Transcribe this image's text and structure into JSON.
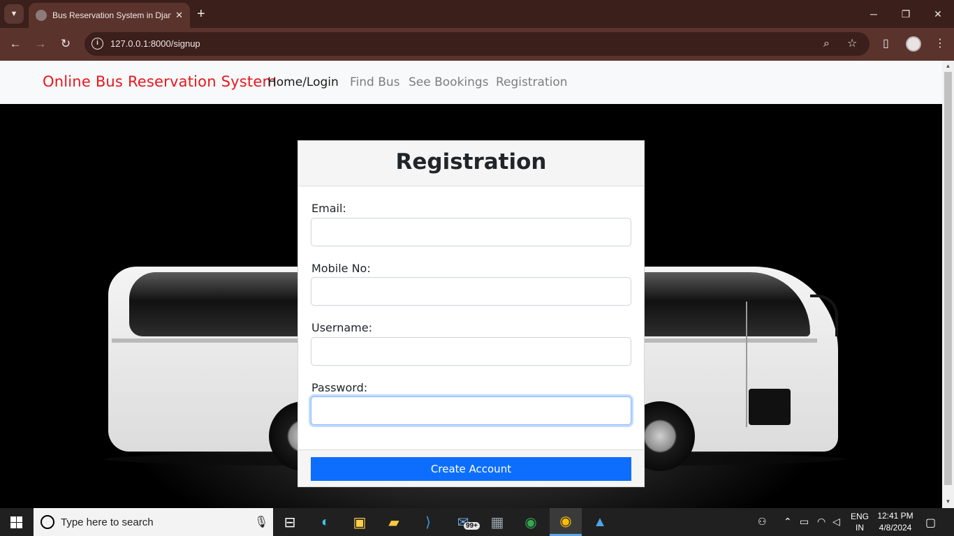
{
  "browser": {
    "tab_title": "Bus Reservation System in Djan",
    "tab_close": "✕",
    "new_tab": "+",
    "url": "127.0.0.1:8000/signup",
    "window_controls": {
      "minimize": "─",
      "restore": "❐",
      "close": "✕"
    }
  },
  "navbar": {
    "brand": "Online Bus Reservation System",
    "links": [
      {
        "label": "Home/Login",
        "active": true
      },
      {
        "label": "Find Bus",
        "active": false
      },
      {
        "label": "See Bookings",
        "active": false
      },
      {
        "label": "Registration",
        "active": false
      }
    ]
  },
  "form": {
    "title": "Registration",
    "fields": [
      {
        "label": "Email:",
        "value": ""
      },
      {
        "label": "Mobile No:",
        "value": ""
      },
      {
        "label": "Username:",
        "value": ""
      },
      {
        "label": "Password:",
        "value": "",
        "focused": true
      }
    ],
    "submit_label": "Create Account"
  },
  "colors": {
    "brand": "#e8171d",
    "primary_button": "#0d6efd",
    "chrome_dark": "#3b1f1b",
    "chrome_toolbar": "#5a332d"
  },
  "taskbar": {
    "search_placeholder": "Type here to search",
    "mail_badge": "99+",
    "language": "ENG",
    "region": "IN",
    "time": "12:41 PM",
    "date": "4/8/2024"
  }
}
